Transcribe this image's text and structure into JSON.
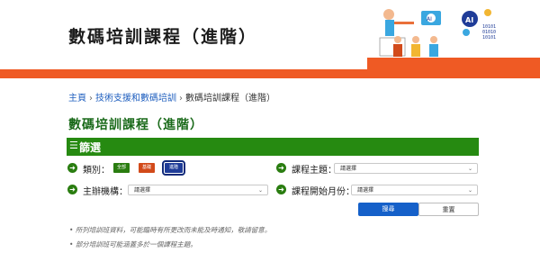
{
  "banner": {
    "title": "數碼培訓課程（進階）"
  },
  "breadcrumb": {
    "items": [
      "主頁",
      "技術支援和數碼培訓"
    ],
    "current": "數碼培訓課程（進階）"
  },
  "page_title": "數碼培訓課程（進階）",
  "filter": {
    "header": "篩選",
    "type_label": "類別：",
    "types": [
      "全部",
      "基礎",
      "進階"
    ],
    "topic_label": "課程主題：",
    "topic_value": "請選擇",
    "org_label": "主辦機構：",
    "org_value": "請選擇",
    "month_label": "課程開始月份：",
    "month_value": "請選擇",
    "search_label": "搜尋",
    "reset_label": "重置"
  },
  "notes": [
    "所列培訓班資料，可能臨時有所更改而未能及時通知，敬請留意。",
    "部分培訓班可能涵蓋多於一個課程主題。"
  ],
  "colors": {
    "brand_orange": "#ef5a24",
    "filter_green": "#268a11",
    "primary_blue": "#1560c9"
  }
}
